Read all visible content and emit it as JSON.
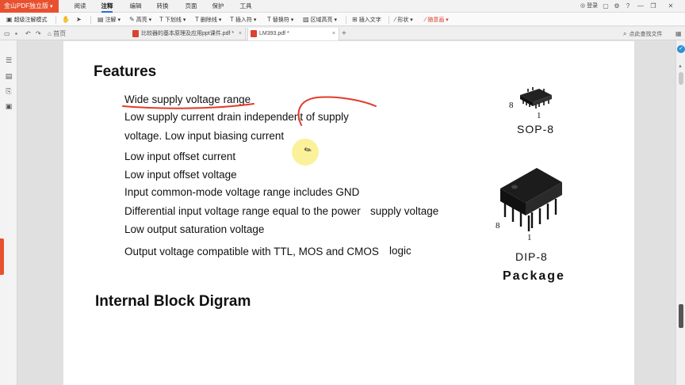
{
  "app": {
    "badge": "金山PDF独立版",
    "caret": "▾"
  },
  "menu": {
    "tabs": [
      "阅读",
      "注释",
      "编辑",
      "转换",
      "页面",
      "保护",
      "工具"
    ],
    "active": "注释",
    "login": "登录"
  },
  "toolbar": {
    "items": [
      {
        "icon": "▣",
        "label": "超级注解模式"
      },
      {
        "icon": "✋",
        "label": ""
      },
      {
        "icon": "➤",
        "label": ""
      },
      {
        "icon": "▤",
        "label": "注解 ▾"
      },
      {
        "icon": "✎",
        "label": "高亮 ▾"
      },
      {
        "icon": "T",
        "label": "下划线 ▾"
      },
      {
        "icon": "T",
        "label": "删除线 ▾"
      },
      {
        "icon": "T",
        "label": "插入符 ▾"
      },
      {
        "icon": "T",
        "label": "替换符 ▾"
      },
      {
        "icon": "▨",
        "label": "区域高亮 ▾"
      },
      {
        "icon": "⊞",
        "label": "插入文字"
      },
      {
        "icon": "∕",
        "label": "形状 ▾"
      },
      {
        "icon": "∕",
        "label": "随意画 ▾"
      }
    ]
  },
  "tabs": {
    "home": "首页",
    "documents": [
      {
        "title": "比较器的基本原理及应用ppt课件.pdf *",
        "close": "×"
      },
      {
        "title": "LM393.pdf *",
        "close": "×"
      }
    ],
    "search_placeholder": "点此查找文件"
  },
  "document": {
    "heading_features": "Features",
    "features": [
      "Wide supply voltage range",
      "Low supply current drain independent of supply",
      "voltage. Low input biasing current",
      "Low input offset current",
      "Low input offset voltage",
      "Input common-mode voltage range includes GND",
      "Differential input voltage range equal to the power",
      "Low output saturation voltage",
      "Output voltage compatible with TTL, MOS and CMOS"
    ],
    "feature_suffix_power": "supply voltage",
    "feature_suffix_cmos": "logic",
    "heading_block": "Internal Block Digram",
    "packages": {
      "sop_label": "SOP-8",
      "sop_pin_high": "8",
      "sop_pin_low": "1",
      "dip_label": "DIP-8",
      "dip_pin_high": "8",
      "dip_pin_low": "1",
      "caption": "Package"
    }
  },
  "colors": {
    "accent": "#e8512f",
    "annotation_red": "#e23b2a",
    "tab_underline": "#2b6ed6",
    "highlight": "#faec78"
  }
}
